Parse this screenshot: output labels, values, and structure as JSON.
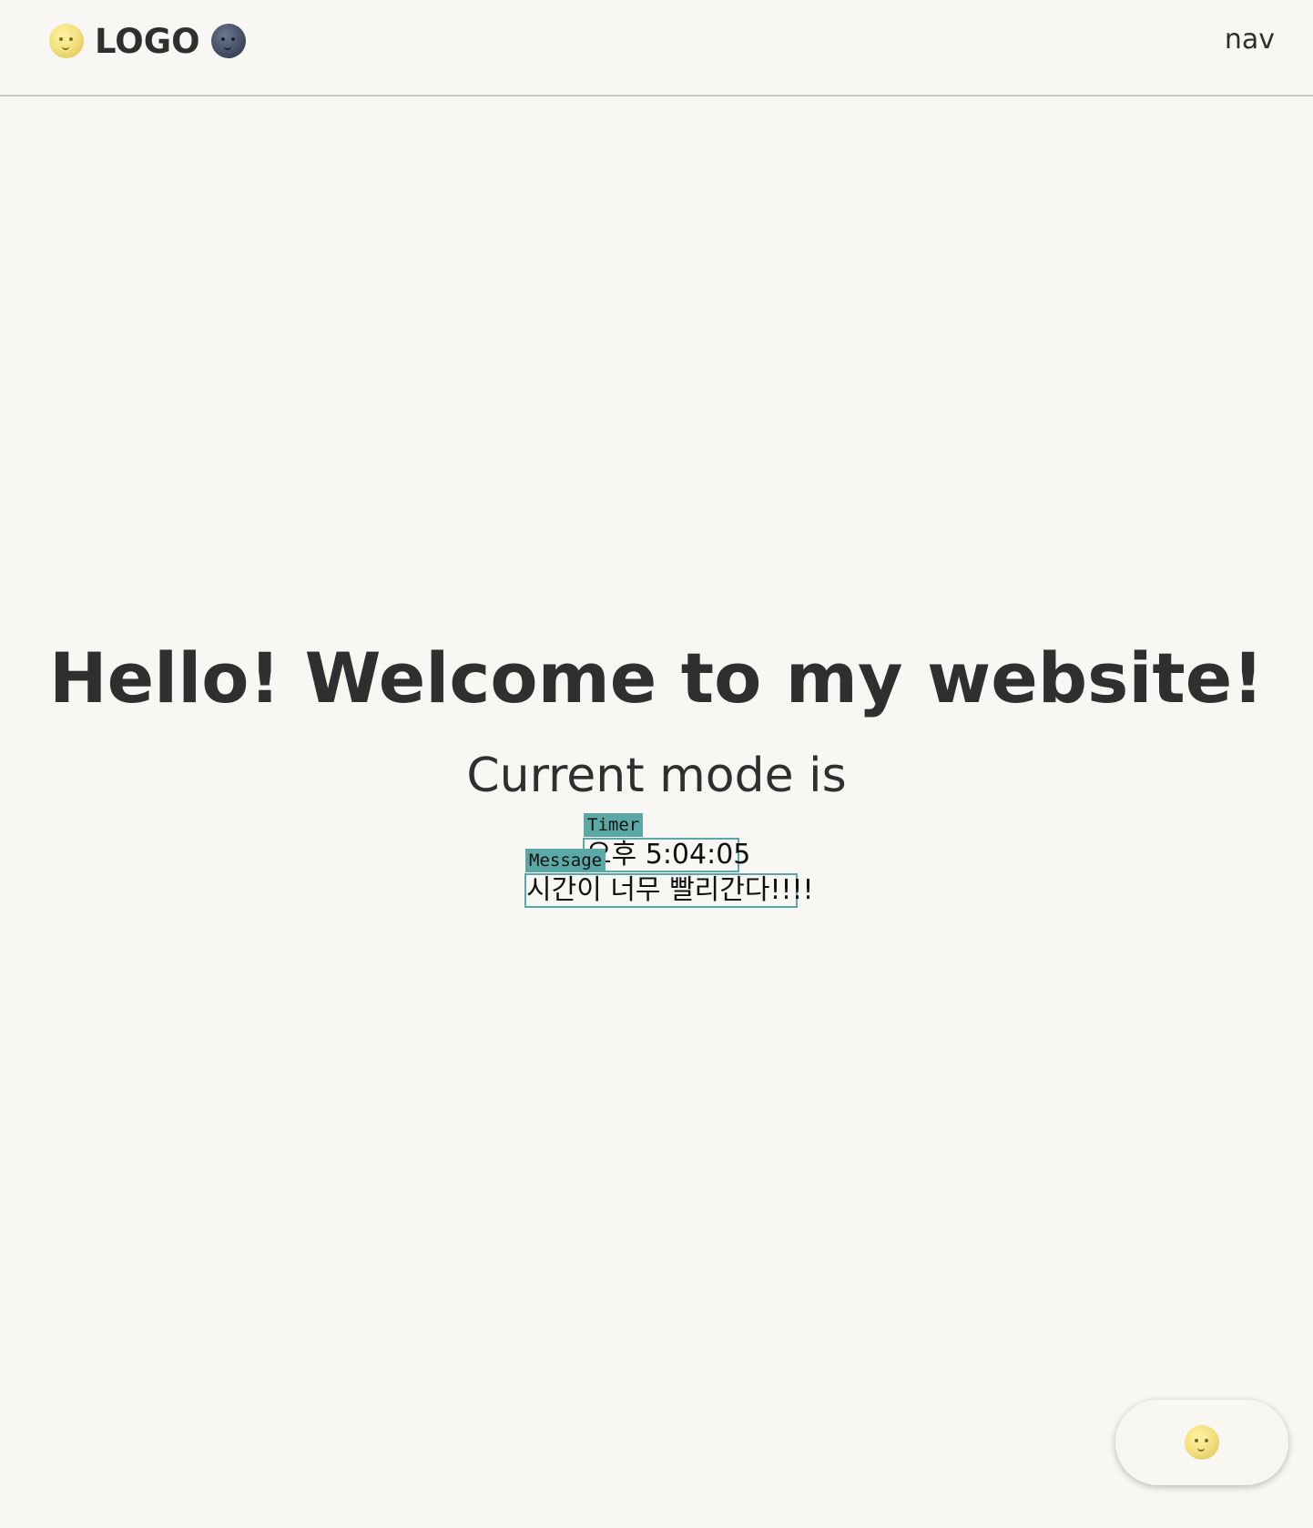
{
  "header": {
    "logo_text": "LOGO",
    "nav_label": "nav"
  },
  "hero": {
    "title": "Hello! Welcome to my website!",
    "mode_text": "Current mode is"
  },
  "timer": {
    "tag_label": "Timer",
    "value": "오후 5:04:05"
  },
  "message": {
    "tag_label": "Message",
    "value": "시간이 너무 빨리간다!!!!"
  },
  "mode_toggle": {
    "icon": "full-moon-face-icon"
  },
  "colors": {
    "background": "#f8f7f4",
    "text": "#2f2f2f",
    "tag_accent": "#5aa9a6"
  }
}
